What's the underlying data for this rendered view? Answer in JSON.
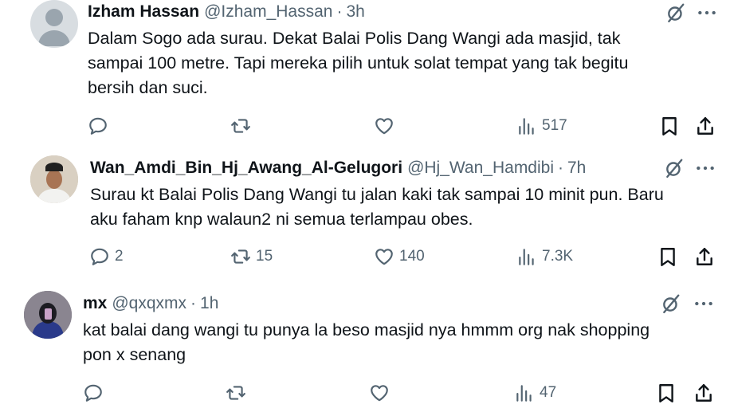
{
  "tweets": [
    {
      "name": "Izham Hassan",
      "handle": "@Izham_Hassan",
      "time": "3h",
      "text": "Dalam Sogo ada surau. Dekat Balai Polis Dang Wangi ada masjid, tak\nsampai 100 metre. Tapi mereka pilih untuk solat tempat yang tak begitu\nbersih dan suci.",
      "replies": "",
      "reposts": "",
      "likes": "",
      "views": "517"
    },
    {
      "name": "Wan_Amdi_Bin_Hj_Awang_Al-Gelugori",
      "handle": "@Hj_Wan_Hamdibi",
      "time": "7h",
      "text": "Surau kt Balai Polis Dang Wangi tu jalan kaki tak sampai 10 minit pun. Baru\naku faham knp walaun2 ni semua terlampau obes.",
      "replies": "2",
      "reposts": "15",
      "likes": "140",
      "views": "7.3K"
    },
    {
      "name": "mx",
      "handle": "@qxqxmx",
      "time": "1h",
      "text": "kat balai dang wangi tu punya la beso masjid nya hmmm org nak shopping\npon x senang",
      "replies": "",
      "reposts": "",
      "likes": "",
      "views": "47"
    }
  ],
  "dot_separator": "·",
  "icons": {
    "grok": "grok-icon",
    "more": "more-icon",
    "reply": "reply-icon",
    "repost": "repost-icon",
    "like": "like-icon",
    "views": "views-icon",
    "bookmark": "bookmark-icon",
    "share": "share-icon"
  },
  "colors": {
    "text": "#0f1419",
    "secondary": "#536471"
  }
}
